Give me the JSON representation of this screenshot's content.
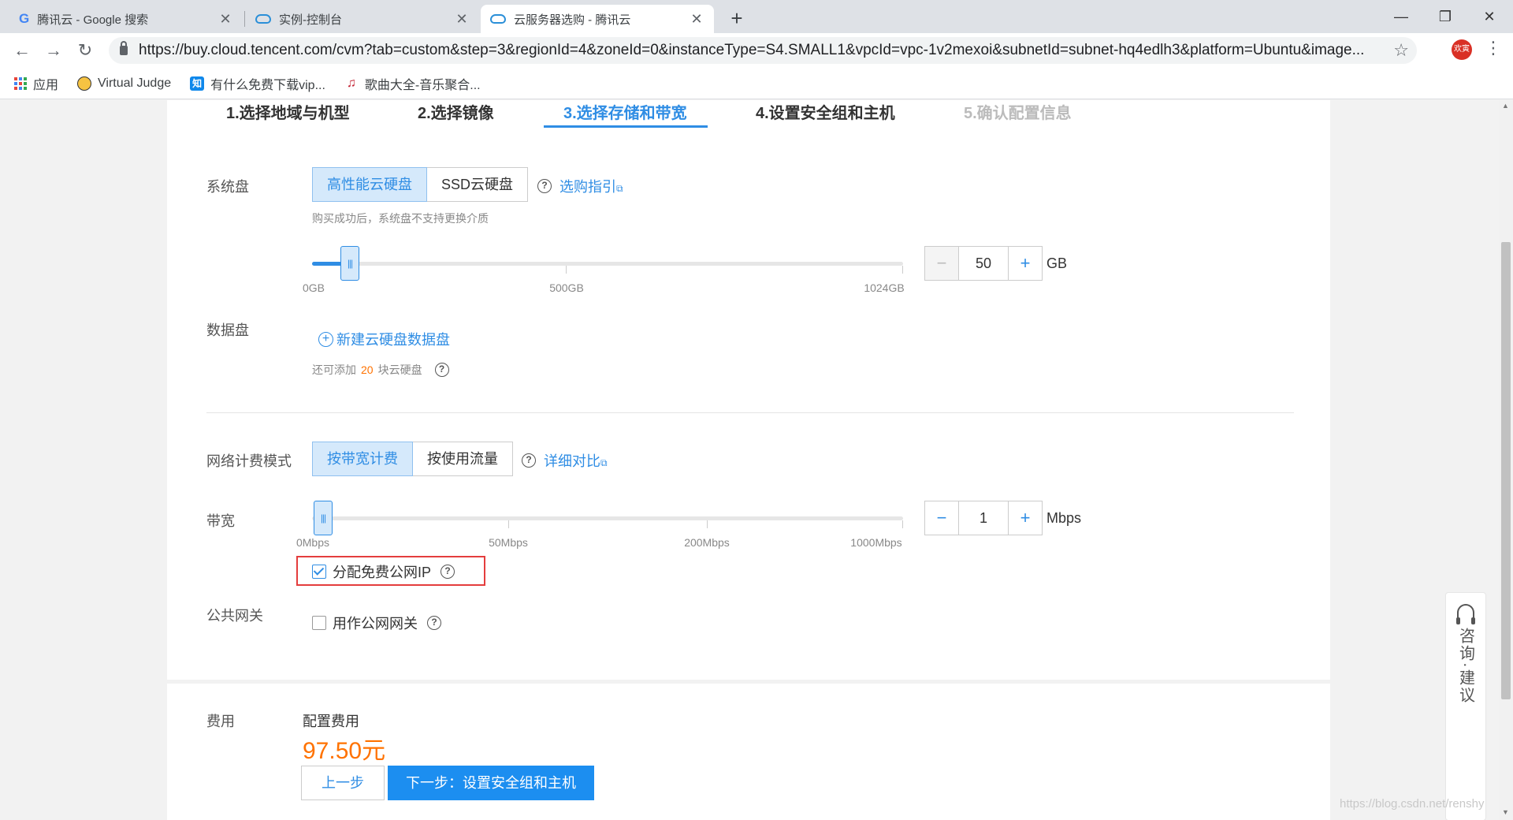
{
  "browser": {
    "tabs": [
      {
        "title": "腾讯云 - Google 搜索",
        "icon": "google-icon"
      },
      {
        "title": "实例-控制台",
        "icon": "tencent-cloud-icon"
      },
      {
        "title": "云服务器选购 - 腾讯云",
        "icon": "tencent-cloud-icon"
      }
    ],
    "new_tab": "+",
    "url": "https://buy.cloud.tencent.com/cvm?tab=custom&step=3&regionId=4&zoneId=0&instanceType=S4.SMALL1&vpcId=vpc-1v2mexoi&subnetId=subnet-hq4edlh3&platform=Ubuntu&image...",
    "profile_label": "欢寅",
    "bookmarks": [
      {
        "label": "应用",
        "icon": "apps-icon"
      },
      {
        "label": "Virtual Judge",
        "icon": "virtual-judge-icon"
      },
      {
        "label": "有什么免费下载vip...",
        "icon": "zhihu-icon"
      },
      {
        "label": "歌曲大全-音乐聚合...",
        "icon": "music-icon"
      }
    ]
  },
  "steps": [
    {
      "label": "1.选择地域与机型",
      "state": "done"
    },
    {
      "label": "2.选择镜像",
      "state": "done"
    },
    {
      "label": "3.选择存储和带宽",
      "state": "active"
    },
    {
      "label": "4.设置安全组和主机",
      "state": "todo"
    },
    {
      "label": "5.确认配置信息",
      "state": "disabled"
    }
  ],
  "system_disk": {
    "label": "系统盘",
    "options": [
      "高性能云硬盘",
      "SSD云硬盘"
    ],
    "selected": "高性能云硬盘",
    "guide_link": "选购指引",
    "note": "购买成功后，系统盘不支持更换介质",
    "slider_value": 50,
    "slider_max": 1024,
    "tick_labels": [
      "0GB",
      "500GB",
      "1024GB"
    ],
    "stepper": {
      "value": "50",
      "minus": "−",
      "plus": "+"
    },
    "unit": "GB"
  },
  "data_disk": {
    "label": "数据盘",
    "add_link": "新建云硬盘数据盘",
    "note_prefix": "还可添加",
    "note_count": "20",
    "note_suffix": "块云硬盘"
  },
  "network": {
    "label": "网络计费模式",
    "options": [
      "按带宽计费",
      "按使用流量"
    ],
    "selected": "按带宽计费",
    "compare_link": "详细对比"
  },
  "bandwidth": {
    "label": "带宽",
    "slider_value": 1,
    "tick_labels": [
      "0Mbps",
      "50Mbps",
      "200Mbps",
      "1000Mbps"
    ],
    "stepper": {
      "value": "1",
      "minus": "−",
      "plus": "+"
    },
    "unit": "Mbps",
    "public_ip_label": "分配免费公网IP",
    "public_ip_checked": true
  },
  "gateway": {
    "label": "公共网关",
    "checkbox_label": "用作公网网关",
    "checked": false
  },
  "footer": {
    "label": "费用",
    "price_label": "配置费用",
    "price": "97.50元",
    "prev_button": "上一步",
    "next_button": "下一步：设置安全组和主机"
  },
  "float_widget": {
    "text": "咨询·建议"
  },
  "watermark": "https://blog.csdn.net/renshy",
  "colors": {
    "accent": "#2f8de4",
    "price": "#ff7200",
    "highlight": "#e43d3d"
  }
}
